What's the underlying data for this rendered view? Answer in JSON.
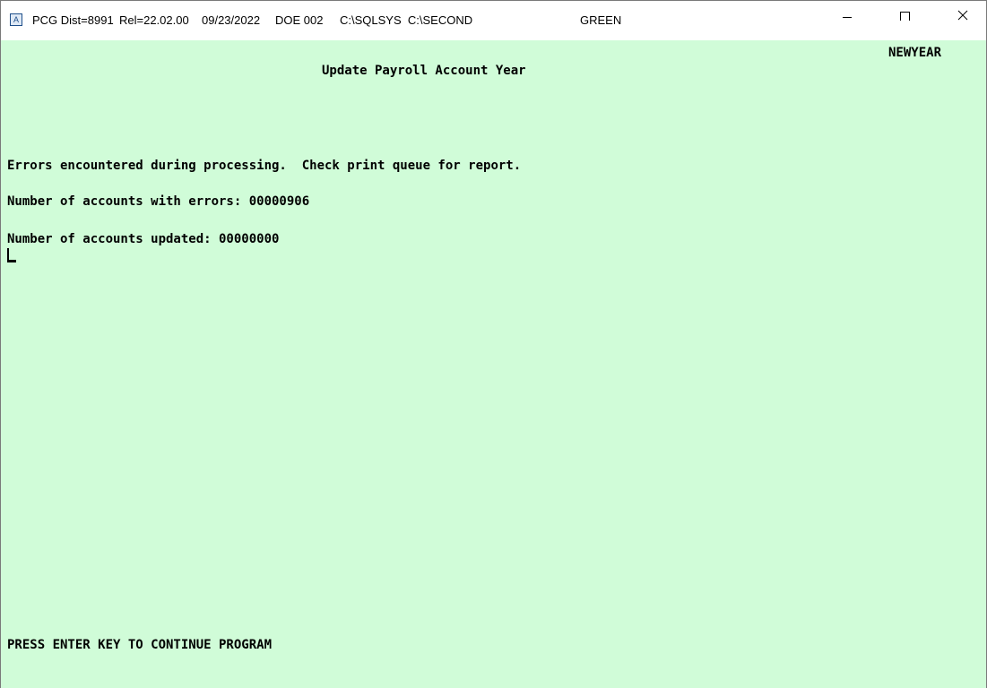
{
  "titlebar": {
    "app_icon_glyph": "A",
    "product": "PCG Dist=8991",
    "release": "Rel=22.02.00",
    "date": "09/23/2022",
    "doe": "DOE 002",
    "paths": "C:\\SQLSYS  C:\\SECOND",
    "color_scheme": "GREEN"
  },
  "window_controls": {
    "minimize": "minimize-icon",
    "maximize": "maximize-icon",
    "close": "close-icon"
  },
  "screen": {
    "background_color": "#d0fcd8",
    "program_id": "NEWYEAR",
    "title": "Update Payroll Account Year",
    "error_message": "Errors encountered during processing.  Check print queue for report.",
    "errors_line": "Number of accounts with errors: 00000906",
    "updated_line": "Number of accounts updated: 00000000",
    "prompt": "PRESS ENTER KEY TO CONTINUE PROGRAM"
  }
}
